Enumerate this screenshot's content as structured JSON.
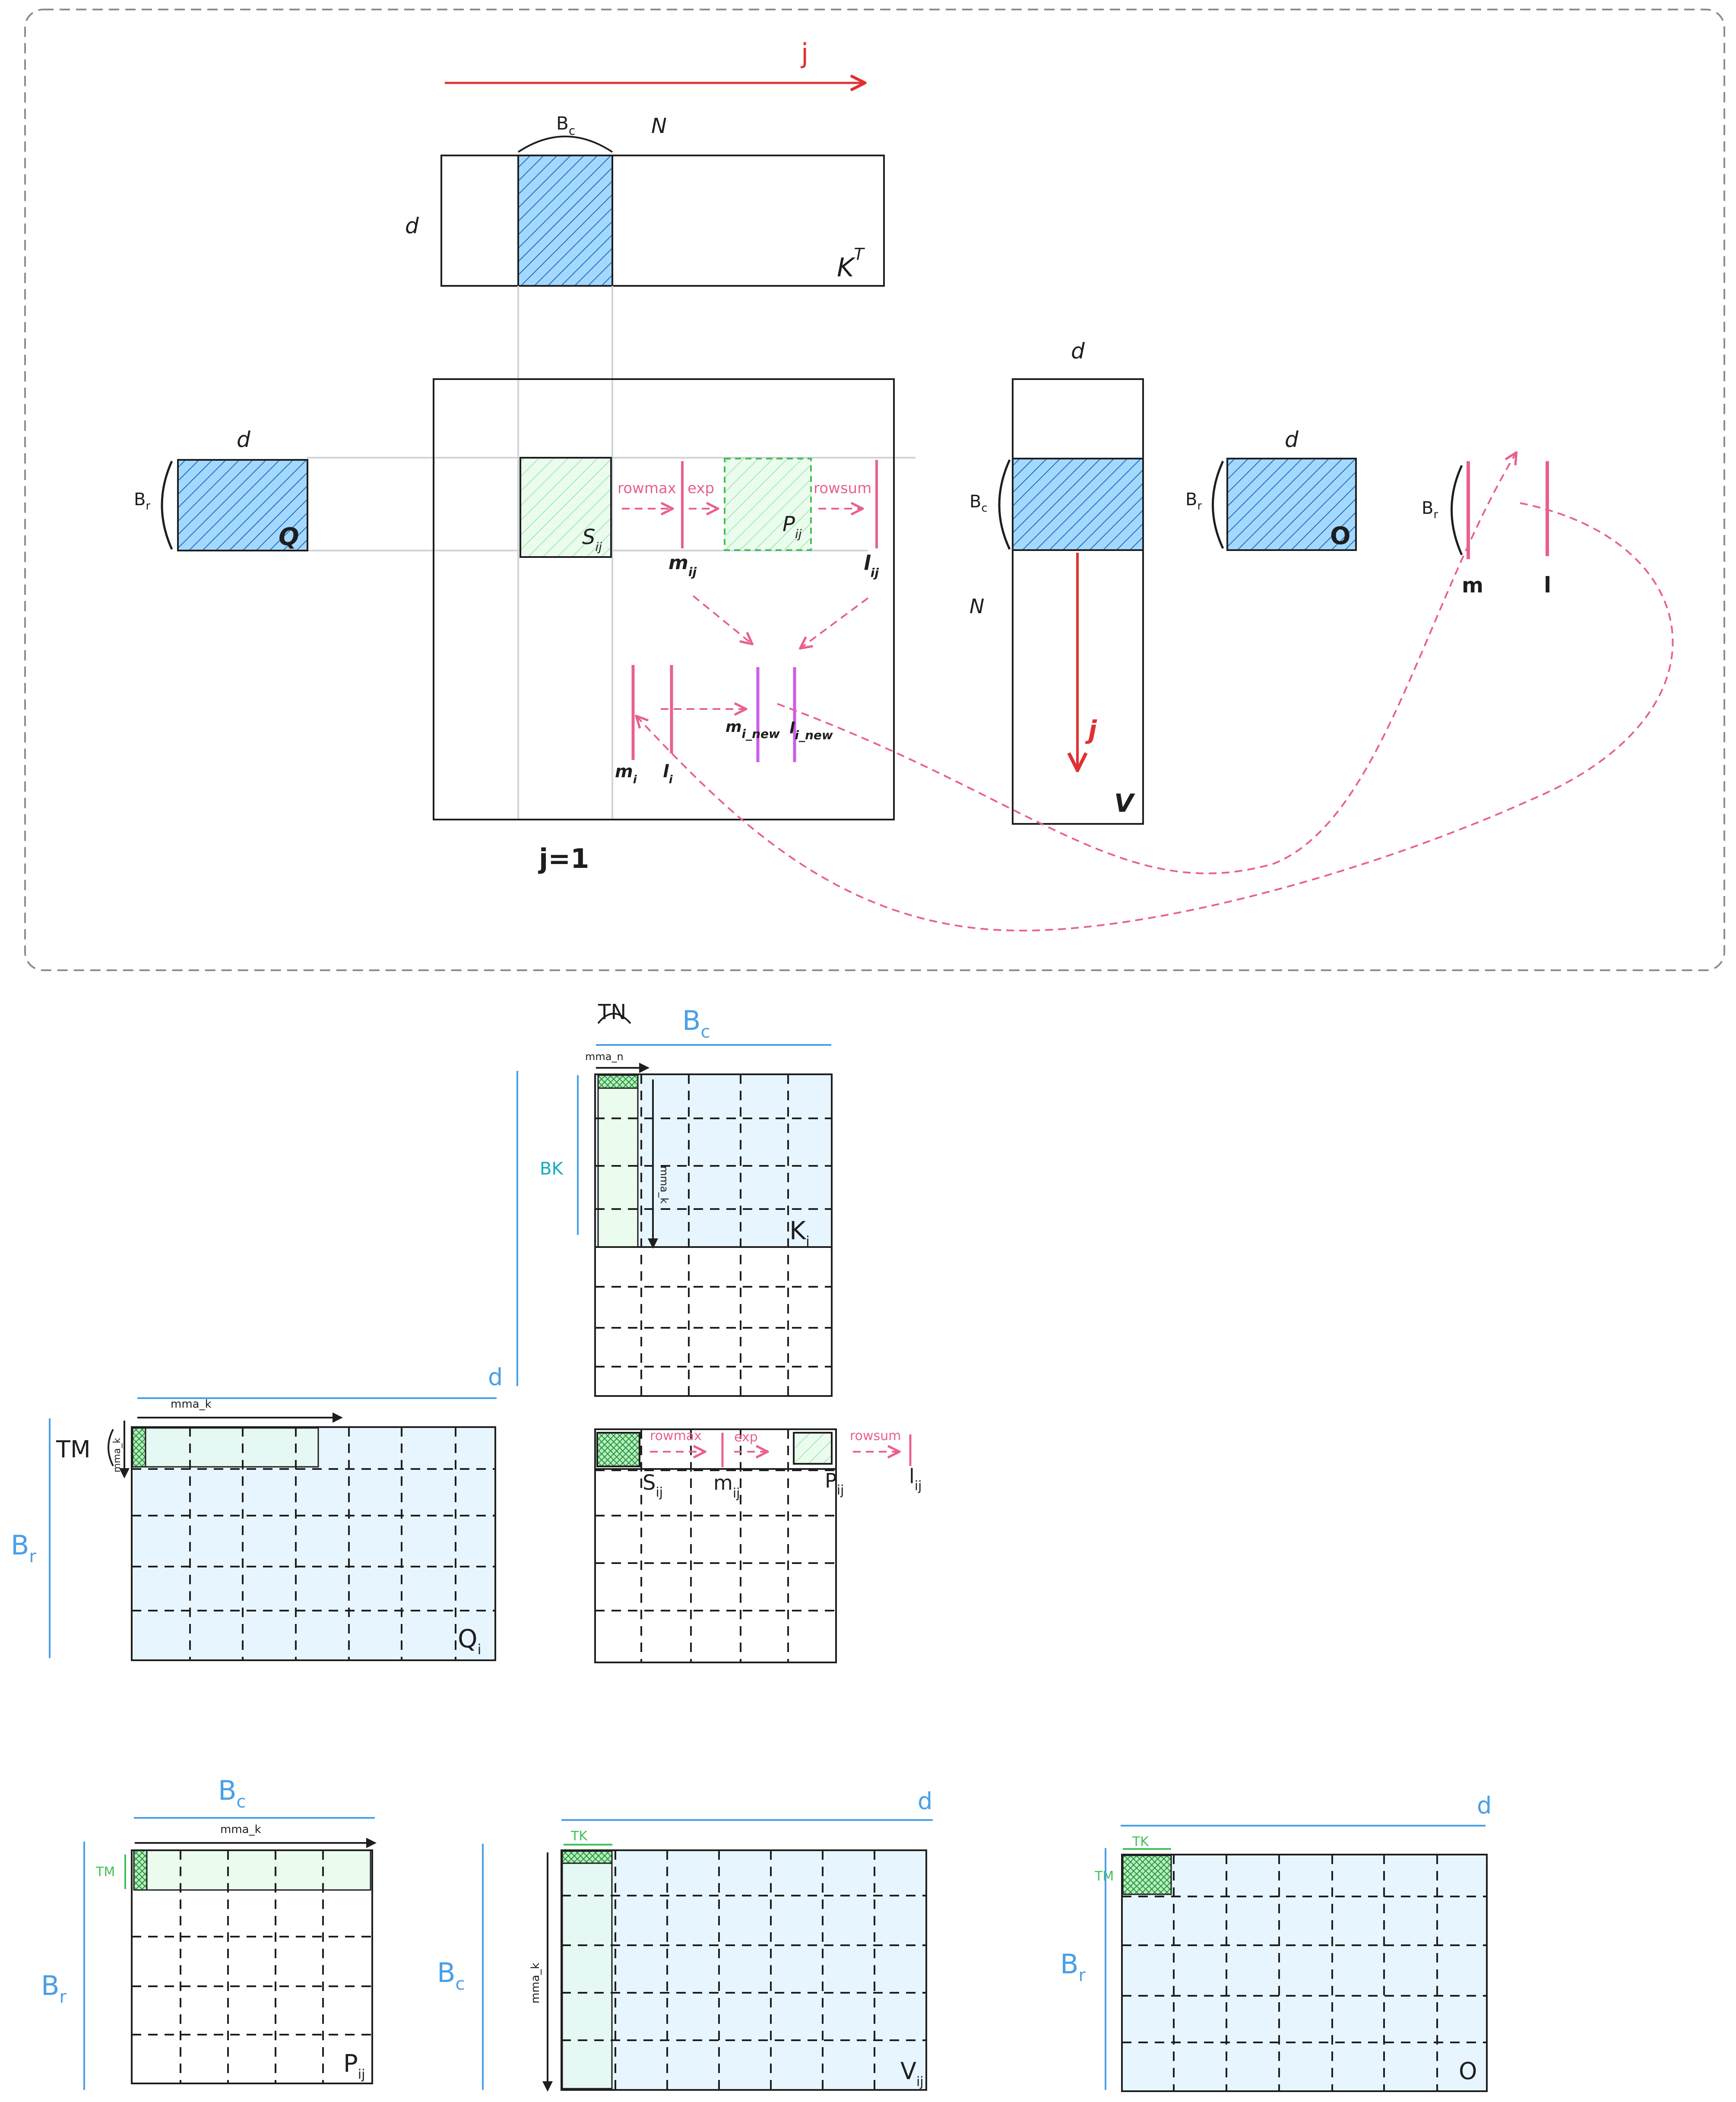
{
  "colors": {
    "ink": "#1e1e1e",
    "blue_hatch": "#1971c2",
    "blue_fill": "#e7f5ff",
    "green_fill": "#ebfbee",
    "green_hatch": "#2f9e44",
    "pink": "#e8618c",
    "magenta": "#cc5de8",
    "red": "#e03131",
    "light_blue_label": "#4a9fe6"
  },
  "overview": {
    "j_arrow": "j",
    "kt": {
      "bc": "Bc",
      "n": "N",
      "d": "d",
      "name": "K",
      "sup": "T"
    },
    "q": {
      "d": "d",
      "br": "Br",
      "name": "Q"
    },
    "s": {
      "name": "S",
      "sub": "ij"
    },
    "m_ij": {
      "name": "m",
      "sub": "ij"
    },
    "p": {
      "name": "P",
      "sub": "ij"
    },
    "l_ij": {
      "name": "l",
      "sub": "ij"
    },
    "rowmax": "rowmax",
    "exp": "exp",
    "rowsum": "rowsum",
    "m_i": {
      "name": "m",
      "sub": "i"
    },
    "l_i": {
      "name": "l",
      "sub": "i"
    },
    "m_new": {
      "name": "m",
      "sub": "i_new"
    },
    "l_new": {
      "name": "l",
      "sub": "i_new"
    },
    "j1": "j=1",
    "v": {
      "d": "d",
      "bc": "Bc",
      "n": "N",
      "name": "V",
      "j": "j"
    },
    "o": {
      "d": "d",
      "br": "Br",
      "name": "O"
    },
    "ml": {
      "br": "Br",
      "m": "m",
      "l": "l"
    }
  },
  "tile_k": {
    "tn": "TN",
    "bc": "Bc",
    "mma_n": "mma_n",
    "bk": "BK",
    "mma_k": "mma_k",
    "name": "K",
    "sub": "i"
  },
  "tile_q": {
    "d": "d",
    "mma_k": "mma_k",
    "tm": "TM",
    "mma_k_vert": "mma_k",
    "br": "Br",
    "name": "Q",
    "sub": "i"
  },
  "tile_s": {
    "s": {
      "name": "S",
      "sub": "ij"
    },
    "m": {
      "name": "m",
      "sub": "ij"
    },
    "p": {
      "name": "P",
      "sub": "ij"
    },
    "l": {
      "name": "l",
      "sub": "ij"
    },
    "rowmax": "rowmax",
    "exp": "exp",
    "rowsum": "rowsum"
  },
  "tile_p": {
    "bc": "Bc",
    "mma_k": "mma_k",
    "tm": "TM",
    "br": "Br",
    "name": "P",
    "sub": "ij"
  },
  "tile_v": {
    "d": "d",
    "tk": "TK",
    "bc": "Bc",
    "mma_k": "mma_k",
    "name": "V",
    "sub": "ij"
  },
  "tile_o": {
    "d": "d",
    "tk": "TK",
    "tm": "TM",
    "br": "Br",
    "name": "O"
  }
}
